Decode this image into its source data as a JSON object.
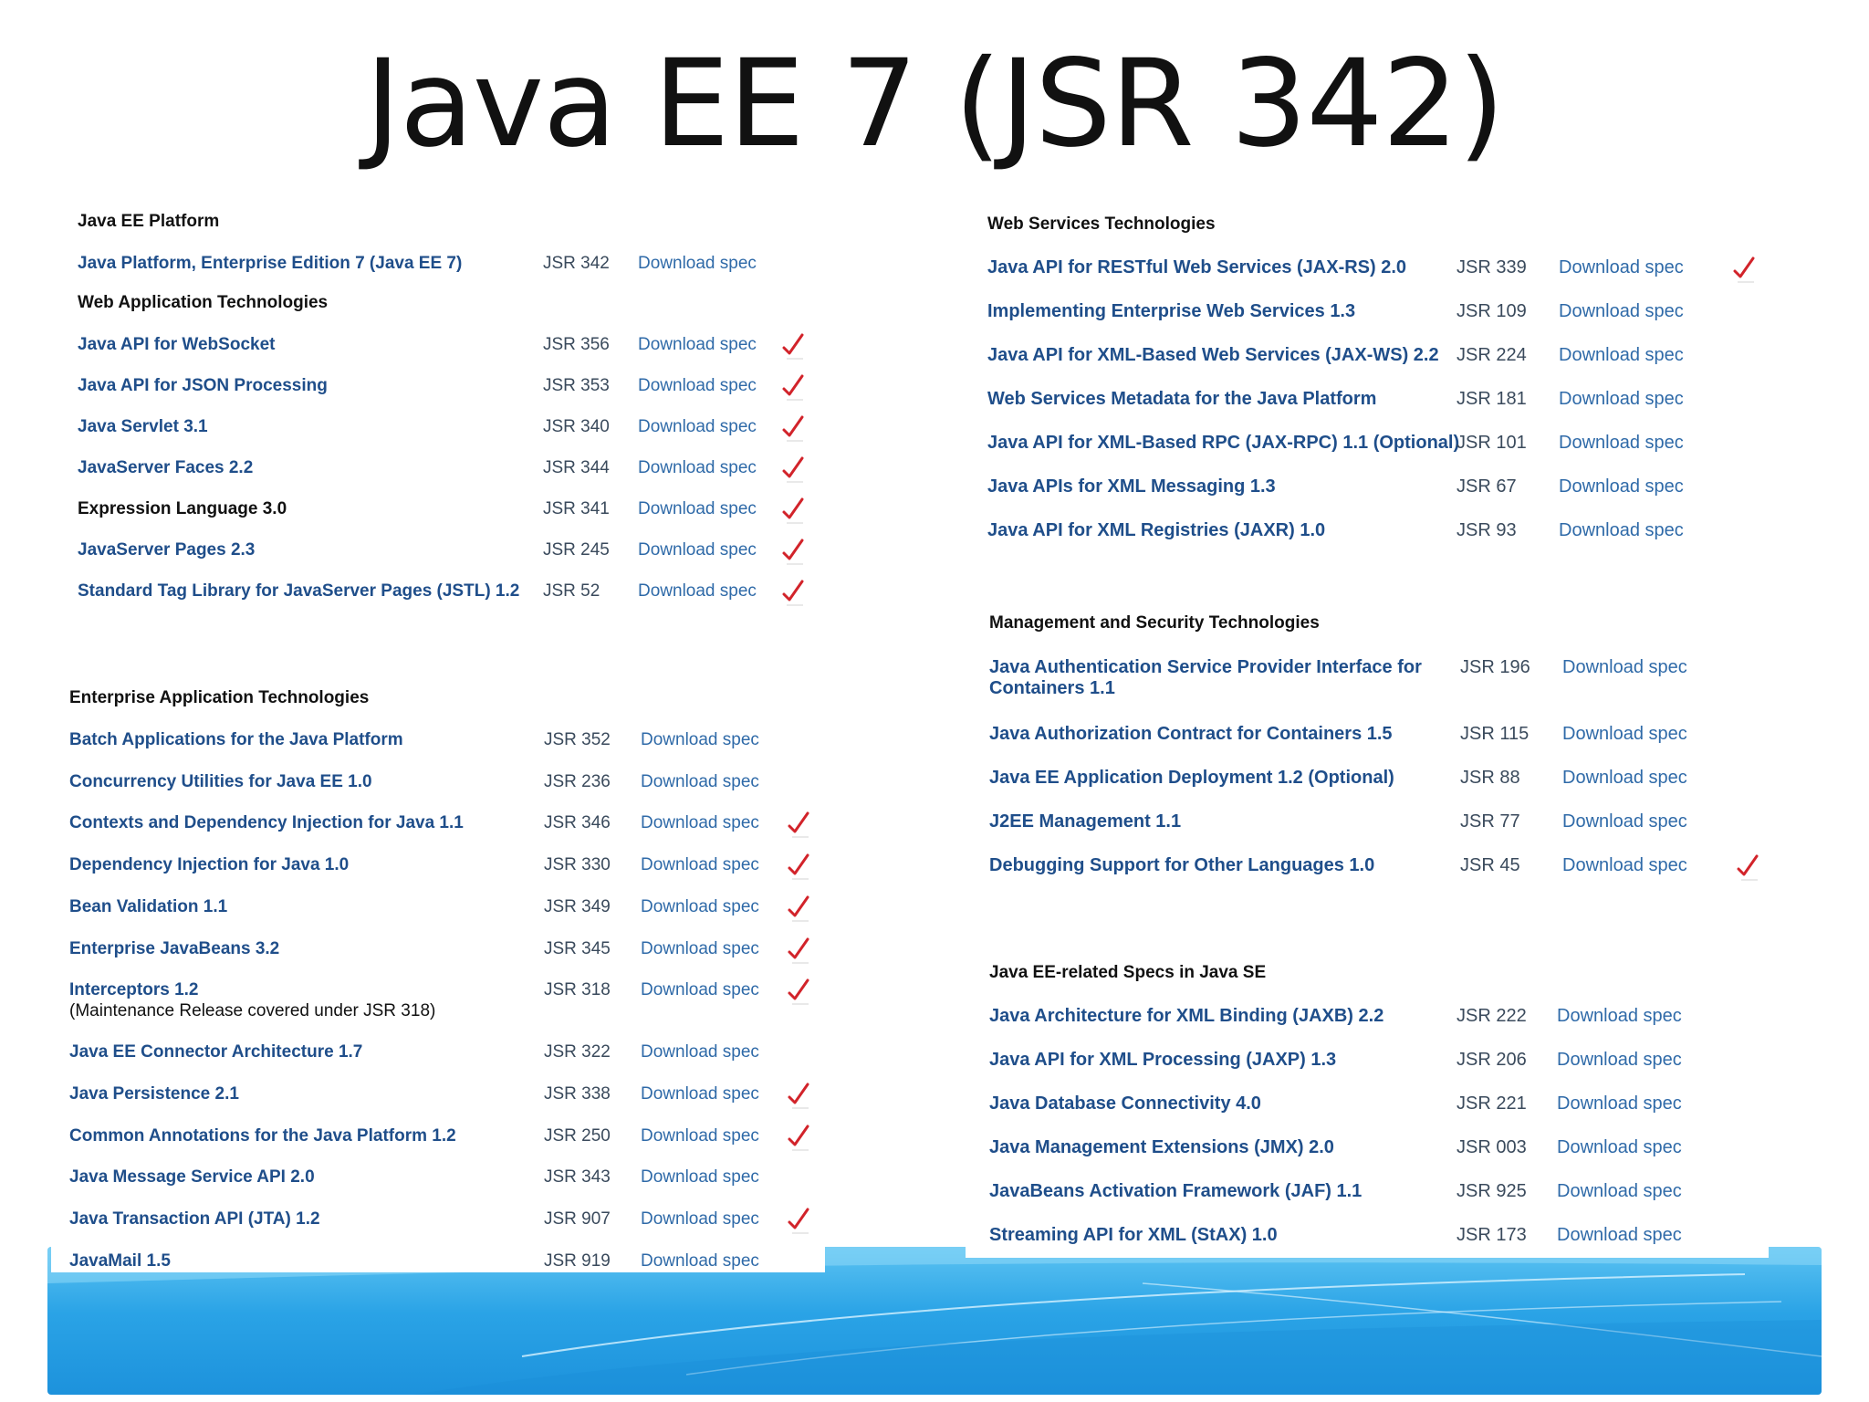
{
  "title": "Java EE 7 (JSR 342)",
  "colors": {
    "link": "#1f4e8a",
    "check": "#d2232a",
    "band": "#2aa3e6"
  },
  "icons": {
    "check": "red-checkmark-icon"
  },
  "left_top": {
    "platform_heading": "Java EE Platform",
    "platform_row": {
      "name": "Java Platform, Enterprise Edition 7 (Java EE 7)",
      "jsr": "JSR 342",
      "download": "Download spec"
    },
    "webapp_heading": "Web Application Technologies",
    "webapp_rows": [
      {
        "name": "Java API for WebSocket",
        "jsr": "JSR 356",
        "download": "Download spec",
        "checked": true
      },
      {
        "name": "Java API for JSON Processing",
        "jsr": "JSR 353",
        "download": "Download spec",
        "checked": true
      },
      {
        "name": "Java Servlet 3.1",
        "jsr": "JSR 340",
        "download": "Download spec",
        "checked": true
      },
      {
        "name": "JavaServer Faces 2.2",
        "jsr": "JSR 344",
        "download": "Download spec",
        "checked": true
      },
      {
        "name": "Expression Language 3.0",
        "jsr": "JSR 341",
        "download": "Download spec",
        "checked": true
      },
      {
        "name": "JavaServer Pages 2.3",
        "jsr": "JSR 245",
        "download": "Download spec",
        "checked": true
      },
      {
        "name": "Standard Tag Library for JavaServer Pages (JSTL) 1.2",
        "jsr": "JSR 52",
        "download": "Download spec",
        "checked": true
      }
    ]
  },
  "left_bottom": {
    "heading": "Enterprise Application Technologies",
    "rows": [
      {
        "name": "Batch Applications for the Java Platform",
        "jsr": "JSR 352",
        "download": "Download spec",
        "checked": false
      },
      {
        "name": "Concurrency Utilities for Java EE 1.0",
        "jsr": "JSR 236",
        "download": "Download spec",
        "checked": false
      },
      {
        "name": "Contexts and Dependency Injection for Java 1.1",
        "jsr": "JSR 346",
        "download": "Download spec",
        "checked": true
      },
      {
        "name": "Dependency Injection for Java 1.0",
        "jsr": "JSR 330",
        "download": "Download spec",
        "checked": true
      },
      {
        "name": "Bean Validation 1.1",
        "jsr": "JSR 349",
        "download": "Download spec",
        "checked": true
      },
      {
        "name": "Enterprise JavaBeans 3.2",
        "jsr": "JSR 345",
        "download": "Download spec",
        "checked": true
      },
      {
        "name": "Interceptors 1.2",
        "note": "(Maintenance Release covered under JSR 318)",
        "jsr": "JSR 318",
        "download": "Download spec",
        "checked": true
      },
      {
        "name": "Java EE Connector Architecture 1.7",
        "jsr": "JSR 322",
        "download": "Download spec",
        "checked": false
      },
      {
        "name": "Java Persistence 2.1",
        "jsr": "JSR 338",
        "download": "Download spec",
        "checked": true
      },
      {
        "name": "Common Annotations for the Java Platform 1.2",
        "jsr": "JSR 250",
        "download": "Download spec",
        "checked": true
      },
      {
        "name": "Java Message Service API 2.0",
        "jsr": "JSR 343",
        "download": "Download spec",
        "checked": false
      },
      {
        "name": "Java Transaction API (JTA) 1.2",
        "jsr": "JSR 907",
        "download": "Download spec",
        "checked": true
      },
      {
        "name": "JavaMail 1.5",
        "jsr": "JSR 919",
        "download": "Download spec",
        "checked": false
      }
    ]
  },
  "right_ws": {
    "heading": "Web Services Technologies",
    "rows": [
      {
        "name": "Java API for RESTful Web Services (JAX-RS) 2.0",
        "jsr": "JSR 339",
        "download": "Download spec",
        "checked": true
      },
      {
        "name": "Implementing Enterprise Web Services 1.3",
        "jsr": "JSR 109",
        "download": "Download spec",
        "checked": false
      },
      {
        "name": "Java API for XML-Based Web Services (JAX-WS) 2.2",
        "jsr": "JSR 224",
        "download": "Download spec",
        "checked": false
      },
      {
        "name": "Web Services Metadata for the Java Platform",
        "jsr": "JSR 181",
        "download": "Download spec",
        "checked": false
      },
      {
        "name": "Java API for XML-Based RPC (JAX-RPC) 1.1 (Optional)",
        "jsr": "JSR 101",
        "download": "Download spec",
        "checked": false
      },
      {
        "name": "Java APIs for XML Messaging 1.3",
        "jsr": "JSR 67",
        "download": "Download spec",
        "checked": false
      },
      {
        "name": "Java API for XML Registries (JAXR) 1.0",
        "jsr": "JSR 93",
        "download": "Download spec",
        "checked": false
      }
    ]
  },
  "right_ms": {
    "heading": "Management and Security Technologies",
    "rows": [
      {
        "name": "Java Authentication Service Provider Interface for",
        "name2": "Containers 1.1",
        "jsr": "JSR 196",
        "download": "Download spec",
        "checked": false
      },
      {
        "name": "Java Authorization Contract for Containers 1.5",
        "jsr": "JSR 115",
        "download": "Download spec",
        "checked": false
      },
      {
        "name": "Java EE Application Deployment 1.2  (Optional)",
        "jsr": "JSR 88",
        "download": "Download spec",
        "checked": false
      },
      {
        "name": "J2EE Management 1.1",
        "jsr": "JSR 77",
        "download": "Download spec",
        "checked": false
      },
      {
        "name": "Debugging Support for Other Languages 1.0",
        "jsr": "JSR 45",
        "download": "Download spec",
        "checked": true
      }
    ]
  },
  "right_se": {
    "heading": "Java EE-related Specs in Java SE",
    "rows": [
      {
        "name": "Java Architecture for XML Binding (JAXB) 2.2",
        "jsr": "JSR 222",
        "download": "Download spec"
      },
      {
        "name": "Java API for XML Processing (JAXP) 1.3",
        "jsr": "JSR 206",
        "download": "Download spec"
      },
      {
        "name": "Java Database Connectivity 4.0",
        "jsr": "JSR 221",
        "download": "Download spec"
      },
      {
        "name": "Java Management Extensions (JMX) 2.0",
        "jsr": "JSR 003",
        "download": "Download spec"
      },
      {
        "name": "JavaBeans Activation Framework (JAF) 1.1",
        "jsr": "JSR 925",
        "download": "Download spec"
      },
      {
        "name": "Streaming API for XML (StAX) 1.0",
        "jsr": "JSR 173",
        "download": "Download spec"
      }
    ]
  }
}
